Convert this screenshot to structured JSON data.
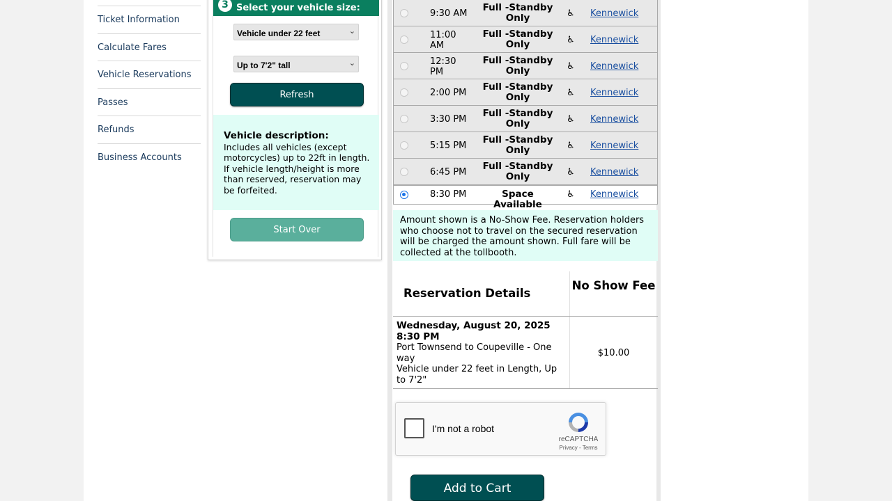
{
  "left_nav": {
    "items": [
      {
        "label": "Ticket Information"
      },
      {
        "label": "Calculate Fares"
      },
      {
        "label": "Vehicle Reservations"
      },
      {
        "label": "Passes"
      },
      {
        "label": "Refunds"
      },
      {
        "label": "Business Accounts"
      }
    ]
  },
  "vehicle_panel": {
    "step_number": "3",
    "step_title": "Select your vehicle size:",
    "length_select": {
      "value": "Vehicle under 22 feet"
    },
    "height_select": {
      "value": "Up to 7'2\" tall"
    },
    "refresh_label": "Refresh",
    "description_title": "Vehicle description:",
    "description_text": "Includes all vehicles (except motorcycles) up to 22ft in length. If vehicle length/height is more than reserved, reservation may be forfeited.",
    "start_over_label": "Start Over"
  },
  "schedule": {
    "rows": [
      {
        "time": "9:30 AM",
        "status": "Full -Standby Only",
        "terminal": "Kennewick",
        "selected": false
      },
      {
        "time": "11:00 AM",
        "status": "Full -Standby Only",
        "terminal": "Kennewick",
        "selected": false
      },
      {
        "time": "12:30 PM",
        "status": "Full -Standby Only",
        "terminal": "Kennewick",
        "selected": false
      },
      {
        "time": "2:00 PM",
        "status": "Full -Standby Only",
        "terminal": "Kennewick",
        "selected": false
      },
      {
        "time": "3:30 PM",
        "status": "Full -Standby Only",
        "terminal": "Kennewick",
        "selected": false
      },
      {
        "time": "5:15 PM",
        "status": "Full -Standby Only",
        "terminal": "Kennewick",
        "selected": false
      },
      {
        "time": "6:45 PM",
        "status": "Full -Standby Only",
        "terminal": "Kennewick",
        "selected": false
      },
      {
        "time": "8:30 PM",
        "status": "Space Available",
        "terminal": "Kennewick",
        "selected": true
      }
    ],
    "accessibility_icon": "wheelchair-icon"
  },
  "noshow_note": "Amount shown is a No-Show Fee. Reservation holders who choose not to travel on the secured reservation will be charged the amount shown. Full fare will be collected at the tollbooth.",
  "reservation": {
    "header_details": "Reservation Details",
    "header_fee": "No Show Fee",
    "date": "Wednesday, August 20, 2025",
    "time": "8:30 PM",
    "route": "Port Townsend to Coupeville - One way",
    "vehicle": "Vehicle under 22 feet in Length, Up to 7'2\"",
    "fee": "$10.00"
  },
  "captcha": {
    "label": "I'm not a robot",
    "brand": "reCAPTCHA",
    "links": "Privacy - Terms"
  },
  "add_to_cart_label": "Add to Cart",
  "colors": {
    "accent_teal": "#004f52",
    "step_green": "#0a7f5f",
    "mint": "#e0fdf6",
    "link_blue": "#1a4fa0"
  }
}
